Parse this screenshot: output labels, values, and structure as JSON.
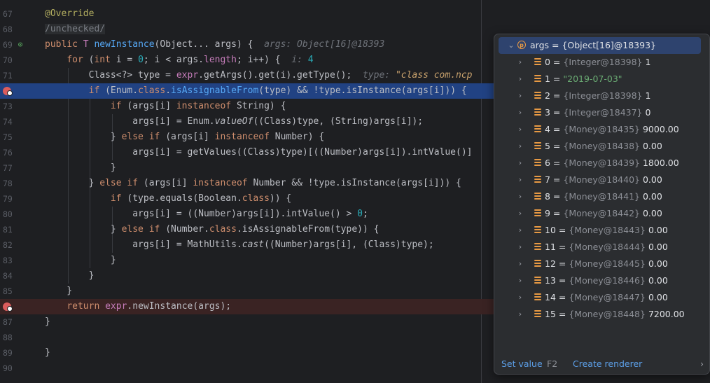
{
  "editor": {
    "lines": [
      {
        "num": "67",
        "tokens": [
          {
            "c": "ann",
            "t": "@Override"
          }
        ]
      },
      {
        "num": "68",
        "tokens": [
          {
            "c": "cm",
            "t": "/unchecked/"
          }
        ]
      },
      {
        "num": "69",
        "override": true,
        "tokens": [
          {
            "c": "kw",
            "t": "public "
          },
          {
            "c": "fld",
            "t": "T "
          },
          {
            "c": "fn",
            "t": "newInstance"
          },
          {
            "t": "(Object... args) {  "
          },
          {
            "c": "hint",
            "t": "args: Object[16]@18393"
          }
        ]
      },
      {
        "num": "70",
        "tokens": [
          {
            "t": "    "
          },
          {
            "c": "kw",
            "t": "for "
          },
          {
            "t": "("
          },
          {
            "c": "kw",
            "t": "int "
          },
          {
            "t": "i = "
          },
          {
            "c": "num",
            "t": "0"
          },
          {
            "t": "; i < args."
          },
          {
            "c": "fld",
            "t": "length"
          },
          {
            "t": "; i++) {  "
          },
          {
            "c": "hint",
            "t": "i: "
          },
          {
            "c": "num",
            "t": "4"
          }
        ]
      },
      {
        "num": "71",
        "tokens": [
          {
            "t": "        Class<?> type = "
          },
          {
            "c": "fld",
            "t": "expr"
          },
          {
            "t": ".getArgs().get(i).getType();  "
          },
          {
            "c": "hint",
            "t": "type: "
          },
          {
            "c": "hint-str",
            "t": "\"class com.ncp"
          }
        ]
      },
      {
        "num": "72",
        "bp": true,
        "exec": true,
        "tokens": [
          {
            "t": "        "
          },
          {
            "c": "kw",
            "t": "if "
          },
          {
            "t": "(Enum."
          },
          {
            "c": "kw",
            "t": "class"
          },
          {
            "t": "."
          },
          {
            "c": "fn",
            "t": "isAssignableFrom"
          },
          {
            "t": "(type) && !type.isInstance(args[i])) {"
          }
        ]
      },
      {
        "num": "73",
        "tokens": [
          {
            "t": "            "
          },
          {
            "c": "kw",
            "t": "if "
          },
          {
            "t": "(args[i] "
          },
          {
            "c": "kw",
            "t": "instanceof "
          },
          {
            "t": "String) {"
          }
        ]
      },
      {
        "num": "74",
        "tokens": [
          {
            "t": "                args[i] = Enum."
          },
          {
            "c": "it",
            "t": "valueOf"
          },
          {
            "t": "((Class)type, (String)args[i]);"
          }
        ]
      },
      {
        "num": "75",
        "tokens": [
          {
            "t": "            } "
          },
          {
            "c": "kw",
            "t": "else if "
          },
          {
            "t": "(args[i] "
          },
          {
            "c": "kw",
            "t": "instanceof "
          },
          {
            "t": "Number) {"
          }
        ]
      },
      {
        "num": "76",
        "tokens": [
          {
            "t": "                args[i] = getValues((Class)type)[((Number)args[i]).intValue()]"
          }
        ]
      },
      {
        "num": "77",
        "tokens": [
          {
            "t": "            }"
          }
        ]
      },
      {
        "num": "78",
        "tokens": [
          {
            "t": "        } "
          },
          {
            "c": "kw",
            "t": "else if "
          },
          {
            "t": "(args[i] "
          },
          {
            "c": "kw",
            "t": "instanceof "
          },
          {
            "t": "Number && !type.isInstance(args[i])) {"
          }
        ]
      },
      {
        "num": "79",
        "tokens": [
          {
            "t": "            "
          },
          {
            "c": "kw",
            "t": "if "
          },
          {
            "t": "(type.equals(Boolean."
          },
          {
            "c": "kw",
            "t": "class"
          },
          {
            "t": ")) {"
          }
        ]
      },
      {
        "num": "80",
        "tokens": [
          {
            "t": "                args[i] = ((Number)args[i]).intValue() > "
          },
          {
            "c": "num",
            "t": "0"
          },
          {
            "t": ";"
          }
        ]
      },
      {
        "num": "81",
        "tokens": [
          {
            "t": "            } "
          },
          {
            "c": "kw",
            "t": "else if "
          },
          {
            "t": "(Number."
          },
          {
            "c": "kw",
            "t": "class"
          },
          {
            "t": ".isAssignableFrom(type)) {"
          }
        ]
      },
      {
        "num": "82",
        "tokens": [
          {
            "t": "                args[i] = MathUtils."
          },
          {
            "c": "it",
            "t": "cast"
          },
          {
            "t": "((Number)args[i], (Class)type);"
          }
        ]
      },
      {
        "num": "83",
        "tokens": [
          {
            "t": "            }"
          }
        ]
      },
      {
        "num": "84",
        "tokens": [
          {
            "t": "        }"
          }
        ]
      },
      {
        "num": "85",
        "tokens": [
          {
            "t": "    }"
          }
        ]
      },
      {
        "num": "86",
        "bp": true,
        "bpline": true,
        "tokens": [
          {
            "t": "    "
          },
          {
            "c": "kw",
            "t": "return "
          },
          {
            "c": "fld",
            "t": "expr"
          },
          {
            "t": ".newInstance(args);"
          }
        ]
      },
      {
        "num": "87",
        "tokens": [
          {
            "t": "}"
          }
        ]
      },
      {
        "num": "88",
        "tokens": []
      },
      {
        "num": "89",
        "tokens": [
          {
            "t": "}"
          }
        ]
      },
      {
        "num": "90",
        "tokens": []
      }
    ]
  },
  "popup": {
    "root": {
      "name": "args",
      "value": "{Object[16]@18393}"
    },
    "items": [
      {
        "index": "0",
        "ref": "{Integer@18398}",
        "value": "1"
      },
      {
        "index": "1",
        "ref": "",
        "value": "\"2019-07-03\"",
        "is_string": true
      },
      {
        "index": "2",
        "ref": "{Integer@18398}",
        "value": "1"
      },
      {
        "index": "3",
        "ref": "{Integer@18437}",
        "value": "0"
      },
      {
        "index": "4",
        "ref": "{Money@18435}",
        "value": "9000.00"
      },
      {
        "index": "5",
        "ref": "{Money@18438}",
        "value": "0.00"
      },
      {
        "index": "6",
        "ref": "{Money@18439}",
        "value": "1800.00"
      },
      {
        "index": "7",
        "ref": "{Money@18440}",
        "value": "0.00"
      },
      {
        "index": "8",
        "ref": "{Money@18441}",
        "value": "0.00"
      },
      {
        "index": "9",
        "ref": "{Money@18442}",
        "value": "0.00"
      },
      {
        "index": "10",
        "ref": "{Money@18443}",
        "value": "0.00"
      },
      {
        "index": "11",
        "ref": "{Money@18444}",
        "value": "0.00"
      },
      {
        "index": "12",
        "ref": "{Money@18445}",
        "value": "0.00"
      },
      {
        "index": "13",
        "ref": "{Money@18446}",
        "value": "0.00"
      },
      {
        "index": "14",
        "ref": "{Money@18447}",
        "value": "0.00"
      },
      {
        "index": "15",
        "ref": "{Money@18448}",
        "value": "7200.00"
      }
    ],
    "footer": {
      "set_value": "Set value",
      "set_value_shortcut": "F2",
      "create_renderer": "Create renderer"
    }
  }
}
